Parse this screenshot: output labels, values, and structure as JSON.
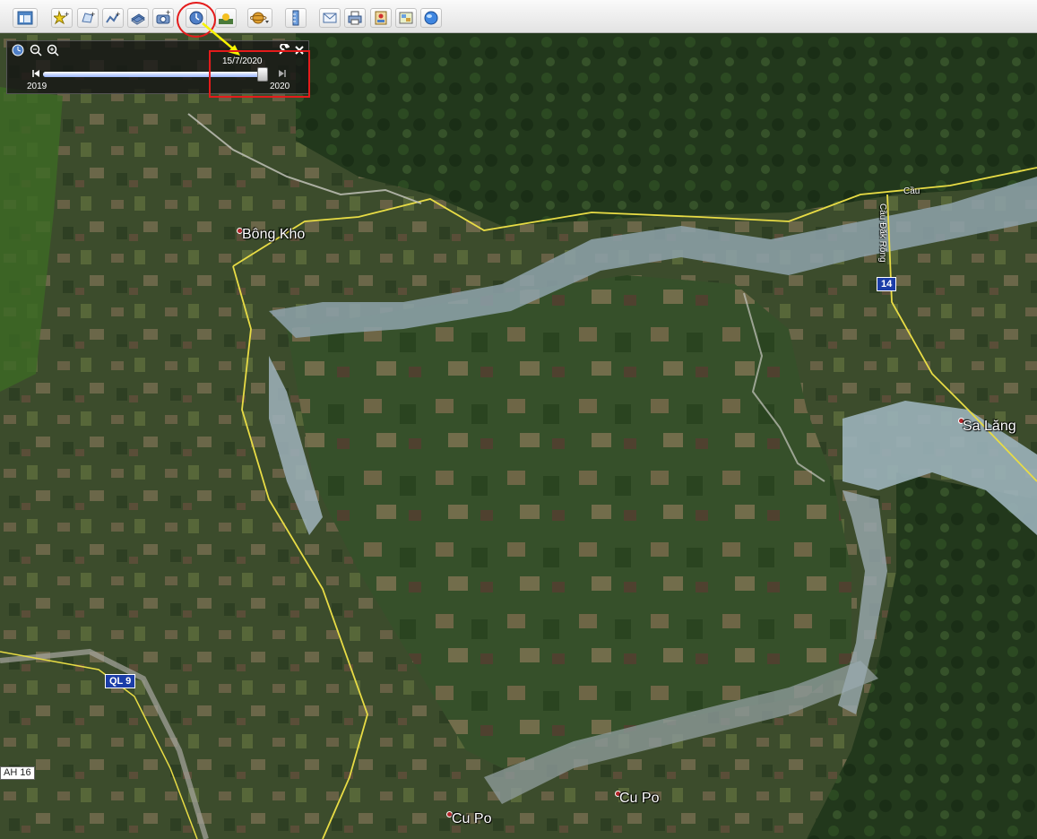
{
  "toolbar": {
    "buttons": [
      {
        "name": "hide-sidebar-button",
        "icon": "sidebar-icon"
      },
      {
        "name": "add-placemark-button",
        "icon": "pushpin-icon"
      },
      {
        "name": "add-polygon-button",
        "icon": "polygon-icon"
      },
      {
        "name": "add-path-button",
        "icon": "path-icon"
      },
      {
        "name": "add-image-overlay-button",
        "icon": "image-overlay-icon"
      },
      {
        "name": "record-tour-button",
        "icon": "camera-icon"
      },
      {
        "name": "historical-imagery-button",
        "icon": "clock-icon"
      },
      {
        "name": "sunlight-button",
        "icon": "sun-icon"
      },
      {
        "name": "switch-planet-button",
        "icon": "planet-icon"
      },
      {
        "name": "ruler-button",
        "icon": "ruler-icon"
      },
      {
        "name": "email-button",
        "icon": "email-icon"
      },
      {
        "name": "print-button",
        "icon": "print-icon"
      },
      {
        "name": "save-image-button",
        "icon": "save-image-icon"
      },
      {
        "name": "view-in-maps-button",
        "icon": "map-view-icon"
      },
      {
        "name": "earth-web-button",
        "icon": "globe-icon"
      }
    ]
  },
  "time_slider": {
    "current_date": "15/7/2020",
    "start_year": "2019",
    "end_year": "2020",
    "position_fraction": 0.98
  },
  "places": [
    {
      "name": "Bông Kho"
    },
    {
      "name": "Sa Lăng"
    },
    {
      "name": "Cu Po"
    },
    {
      "name": "Cu Po"
    }
  ],
  "small_labels": {
    "bridge": "Cầu",
    "bridge_vertical": "Cầu Đăk Rông"
  },
  "routes": {
    "r14": "14",
    "ql9": "QL 9",
    "ah16": "AH 16"
  },
  "colors": {
    "annotation_red": "#e41b1b",
    "annotation_yellow": "#f7f300",
    "road_yellow": "#e8dc45",
    "route_badge_blue": "#1b3da8"
  }
}
